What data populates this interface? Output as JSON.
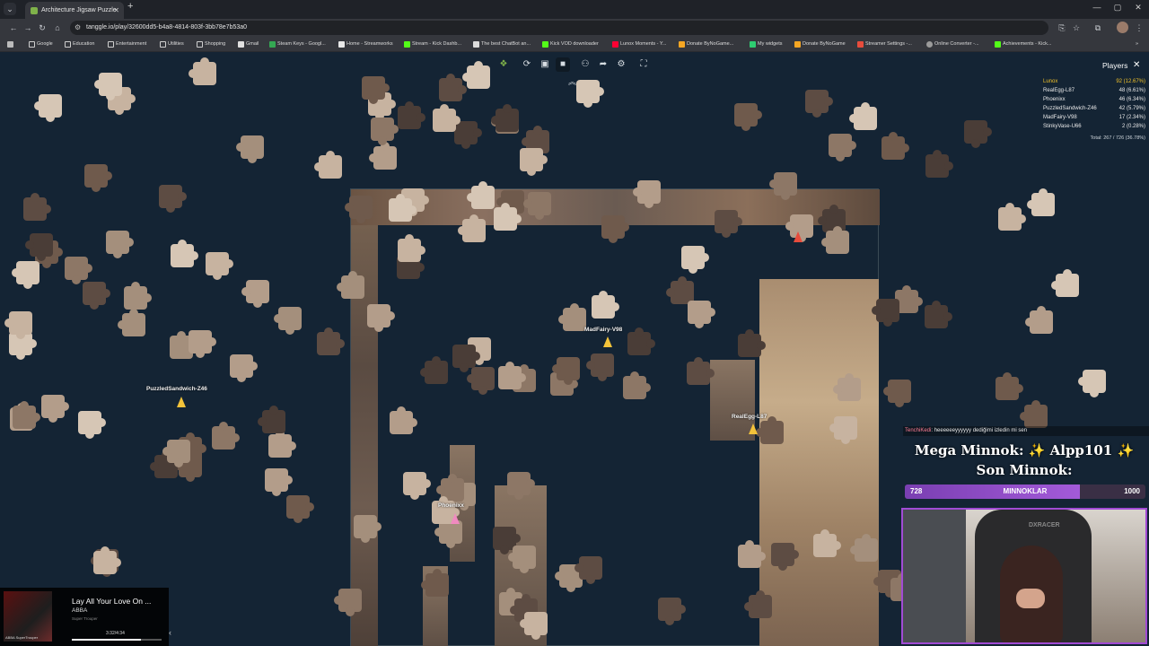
{
  "browser": {
    "tab_title": "Architecture Jigsaw Puzzle",
    "url": "tanggle.io/play/32600dd5-b4a8-4814-803f-3bb78e7b53a0",
    "bookmarks": [
      {
        "label": "Google",
        "icon": "folder-icon"
      },
      {
        "label": "Education",
        "icon": "folder-icon"
      },
      {
        "label": "Entertainment",
        "icon": "folder-icon"
      },
      {
        "label": "Utilities",
        "icon": "folder-icon"
      },
      {
        "label": "Shopping",
        "icon": "folder-icon"
      },
      {
        "label": "Gmail",
        "icon": "gmail-icon"
      },
      {
        "label": "Steam Keys - Googl...",
        "icon": "sheets-icon"
      },
      {
        "label": "Home - Streamworks",
        "icon": "streamworks-icon"
      },
      {
        "label": "Stream - Kick Dashb...",
        "icon": "kick-icon"
      },
      {
        "label": "The best ChatBot an...",
        "icon": "chatbot-icon"
      },
      {
        "label": "Kick VOD downloader",
        "icon": "kick-icon"
      },
      {
        "label": "Lunox Moments - Y...",
        "icon": "youtube-icon"
      },
      {
        "label": "Donate ByNoGame...",
        "icon": "donate-icon"
      },
      {
        "label": "My widgets",
        "icon": "widget-icon"
      },
      {
        "label": "Donate ByNoGame",
        "icon": "donate-icon"
      },
      {
        "label": "Streamer Settings -...",
        "icon": "settings-icon"
      },
      {
        "label": "Online Converter -...",
        "icon": "globe-icon"
      },
      {
        "label": "Achievements - Kick...",
        "icon": "kick-icon"
      }
    ]
  },
  "players_panel": {
    "title": "Players",
    "players": [
      {
        "name": "Lunox",
        "score": "92 (12.67%)"
      },
      {
        "name": "RealEgg-L87",
        "score": "48 (6.61%)"
      },
      {
        "name": "Phoenixx",
        "score": "46 (6.34%)"
      },
      {
        "name": "PuzzledSandwich-Z46",
        "score": "42 (5.79%)"
      },
      {
        "name": "MadFairy-V98",
        "score": "17 (2.34%)"
      },
      {
        "name": "StinkyVase-U66",
        "score": "2 (0.28%)"
      }
    ],
    "total": "Total: 267 / 726 (36.78%)"
  },
  "cursors": {
    "madfairy": "MadFairy-V98",
    "puzzled": "PuzzledSandwich-Z46",
    "realegg": "RealEgg-L87",
    "phoenixx": "Phoenixx"
  },
  "stream": {
    "chat_name": "TenchiKedi",
    "chat_text": ": heeeeeeyyyyyy dediğimi izledin mi sen",
    "mega": "Mega Minnok: ✨ Alpp101 ✨",
    "son": "Son Minnok:",
    "bar_current": "728",
    "bar_label": "MINNOKLAR",
    "bar_goal": "1000",
    "bar_progress": 0.728,
    "chair_brand": "DXRACER"
  },
  "music": {
    "title": "Lay All Your Love On ...",
    "artist": "ABBA",
    "album": "Super Trouper",
    "cover_text": "ABBA SuperTrouper",
    "time": "3:32/4:34",
    "progress": 0.773
  },
  "colors": {
    "board": "#142434",
    "leader": "#f0c12a",
    "minnok_bar": "#a35ad8",
    "webcam_border": "#a14bd4"
  }
}
